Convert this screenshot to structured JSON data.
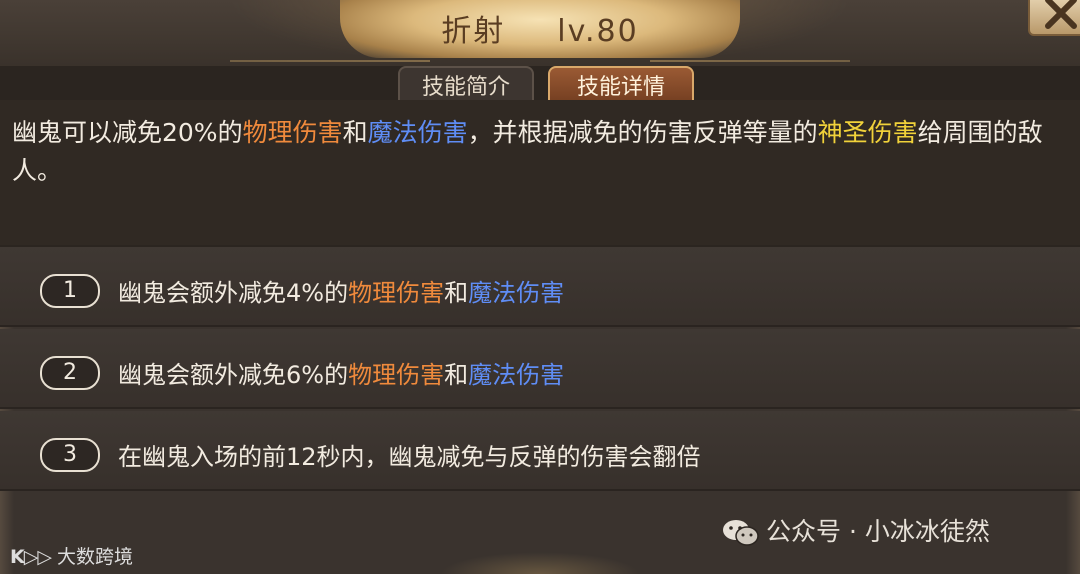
{
  "header": {
    "skill_name": "折射",
    "level": "lv.80"
  },
  "tabs": [
    {
      "label": "技能简介",
      "active": false
    },
    {
      "label": "技能详情",
      "active": true
    }
  ],
  "description": {
    "part1": "幽鬼可以减免20%的",
    "phys": "物理伤害",
    "and": "和",
    "mag": "魔法伤害",
    "part2": "，并根据减免的伤害反弹等量的",
    "holy": "神圣伤害",
    "part3": "给周围的敌人。"
  },
  "upgrades": [
    {
      "num": "1",
      "prefix": "幽鬼会额外减免4%的",
      "phys": "物理伤害",
      "and": "和",
      "mag": "魔法伤害"
    },
    {
      "num": "2",
      "prefix": "幽鬼会额外减免6%的",
      "phys": "物理伤害",
      "and": "和",
      "mag": "魔法伤害"
    },
    {
      "num": "3",
      "text": "在幽鬼入场的前12秒内，幽鬼减免与反弹的伤害会翻倍"
    }
  ],
  "watermarks": {
    "right": "公众号 · 小冰冰徒然",
    "left_logo": "K▷▷",
    "left_text": "大数跨境"
  },
  "colors": {
    "physical": "#f08a3c",
    "magic": "#5f8df5",
    "holy": "#f1d23a",
    "active_tab": "#8a4c2a"
  },
  "icons": [
    "close-icon",
    "wechat-icon"
  ]
}
